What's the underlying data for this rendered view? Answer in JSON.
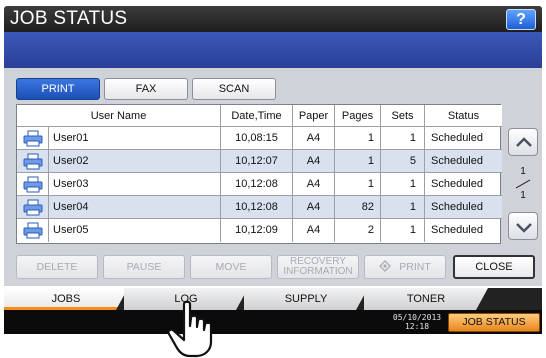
{
  "window": {
    "title": "JOB STATUS",
    "help_label": "?"
  },
  "mode_tabs": [
    {
      "label": "PRINT",
      "active": true
    },
    {
      "label": "FAX",
      "active": false
    },
    {
      "label": "SCAN",
      "active": false
    }
  ],
  "table": {
    "headers": [
      "User Name",
      "Date,Time",
      "Paper",
      "Pages",
      "Sets",
      "Status"
    ],
    "rows": [
      {
        "user": "User01",
        "datetime": "10,08:15",
        "paper": "A4",
        "pages": "1",
        "sets": "1",
        "status": "Scheduled"
      },
      {
        "user": "User02",
        "datetime": "10,12:07",
        "paper": "A4",
        "pages": "1",
        "sets": "5",
        "status": "Scheduled"
      },
      {
        "user": "User03",
        "datetime": "10,12:08",
        "paper": "A4",
        "pages": "1",
        "sets": "1",
        "status": "Scheduled"
      },
      {
        "user": "User04",
        "datetime": "10,12:08",
        "paper": "A4",
        "pages": "82",
        "sets": "1",
        "status": "Scheduled"
      },
      {
        "user": "User05",
        "datetime": "10,12:09",
        "paper": "A4",
        "pages": "2",
        "sets": "1",
        "status": "Scheduled"
      }
    ]
  },
  "pager": {
    "current": "1",
    "total": "1"
  },
  "actions": {
    "delete": "DELETE",
    "pause": "PAUSE",
    "move": "MOVE",
    "recovery_line1": "RECOVERY",
    "recovery_line2": "INFORMATION",
    "print": "PRINT",
    "close": "CLOSE"
  },
  "bottom_tabs": [
    {
      "label": "JOBS",
      "active": true
    },
    {
      "label": "LOG",
      "active": false
    },
    {
      "label": "SUPPLY",
      "active": false
    },
    {
      "label": "TONER",
      "active": false
    }
  ],
  "status_bar": {
    "date": "05/10/2013",
    "time": "12:18",
    "job_status_label": "JOB STATUS"
  },
  "colors": {
    "accent_blue": "#1c4fb6",
    "tab_highlight": "#ff8a1c",
    "job_status_button": "#e8861c"
  }
}
